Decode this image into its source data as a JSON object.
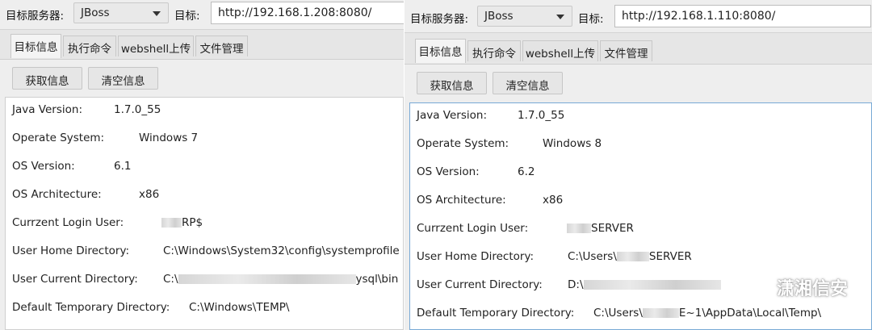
{
  "left": {
    "server_label": "目标服务器:",
    "server_value": "JBoss",
    "target_label": "目标:",
    "url": "http://192.168.1.208:8080/",
    "tabs": [
      "目标信息",
      "执行命令",
      "webshell上传",
      "文件管理"
    ],
    "buttons": {
      "get_info": "获取信息",
      "clear_info": "清空信息"
    },
    "rows": [
      {
        "key": "Java Version:",
        "value": "1.7.0_55"
      },
      {
        "key": "Operate System:",
        "value": "Windows 7"
      },
      {
        "key": "OS Version:",
        "value": "6.1"
      },
      {
        "key": "OS Architecture:",
        "value": "x86"
      },
      {
        "key": "Currzent Login User:",
        "value": "RP$"
      },
      {
        "key": "User Home Directory:",
        "value": "C:\\Windows\\System32\\config\\systemprofile"
      },
      {
        "key": "User Current Directory:",
        "value": "C:\\",
        "value_end": "ysql\\bin"
      },
      {
        "key": "Default Temporary Directory:",
        "value": "C:\\Windows\\TEMP\\"
      }
    ]
  },
  "right": {
    "server_label": "目标服务器:",
    "server_value": "JBoss",
    "target_label": "目标:",
    "url": "http://192.168.1.110:8080/",
    "tabs": [
      "目标信息",
      "执行命令",
      "webshell上传",
      "文件管理"
    ],
    "buttons": {
      "get_info": "获取信息",
      "clear_info": "清空信息"
    },
    "rows": [
      {
        "key": "Java Version:",
        "value": "1.7.0_55"
      },
      {
        "key": "Operate System:",
        "value": "Windows 8"
      },
      {
        "key": "OS Version:",
        "value": "6.2"
      },
      {
        "key": "OS Architecture:",
        "value": "x86"
      },
      {
        "key": "Currzent Login User:",
        "value": "SERVER"
      },
      {
        "key": "User Home Directory:",
        "value": "C:\\Users\\",
        "value_end": "SERVER"
      },
      {
        "key": "User Current Directory:",
        "value": "D:\\"
      },
      {
        "key": "Default Temporary Directory:",
        "value": "C:\\Users\\",
        "value_end": "E~1\\AppData\\Local\\Temp\\"
      }
    ]
  },
  "watermark": "潇湘信安"
}
